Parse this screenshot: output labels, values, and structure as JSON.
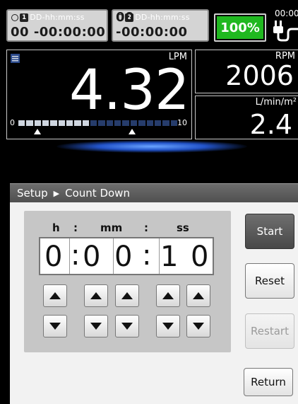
{
  "timers": [
    {
      "number": "1",
      "format": "DD-hh:mm:ss",
      "value": "00 -00:00:00"
    },
    {
      "number": "2",
      "format": "DD-hh:mm:ss",
      "value": "00 -00:00:00"
    }
  ],
  "battery": {
    "label": "100%",
    "level": 1.0,
    "color": "#20b820"
  },
  "clock_partial": "00:00",
  "flow": {
    "unit": "LPM",
    "value": "4.32",
    "scale_min": "0",
    "scale_max": "10",
    "fill_fraction": 0.45
  },
  "rpm": {
    "unit": "RPM",
    "value": "2006"
  },
  "cardiac_index": {
    "unit": "L/min/m²",
    "value": "2.4"
  },
  "setup": {
    "title": "Setup",
    "subtitle": "Count Down",
    "headers": {
      "h": "h",
      "colon1": ":",
      "mm": "mm",
      "colon2": ":",
      "ss": "ss"
    },
    "digits": [
      "0",
      "0",
      "0",
      "1",
      "0"
    ],
    "colon": ":",
    "buttons": {
      "start": "Start",
      "reset": "Reset",
      "restart": "Restart",
      "return": "Return"
    }
  },
  "icons": [
    "timer-clock-icon",
    "plug-icon",
    "settings-icon",
    "up-arrow-icon",
    "down-arrow-icon",
    "breadcrumb-arrow-icon"
  ]
}
